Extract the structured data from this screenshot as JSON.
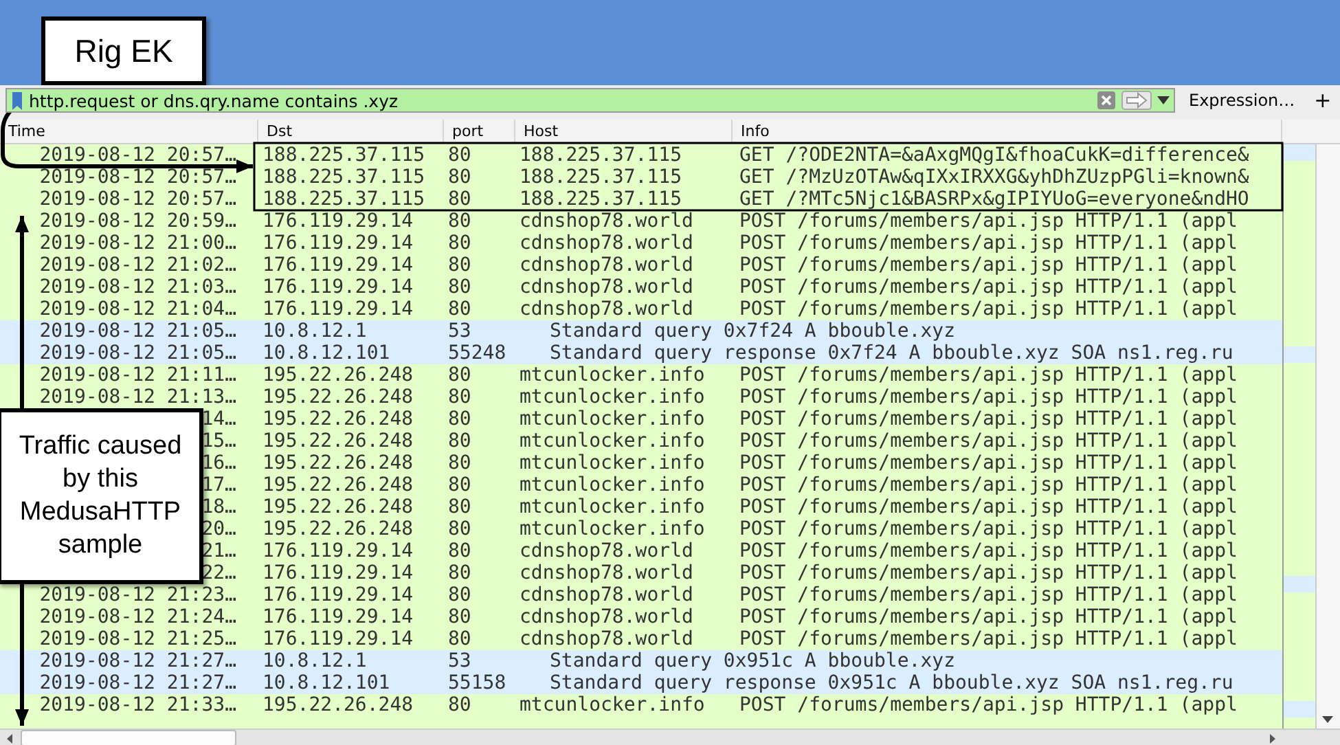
{
  "filter": {
    "value": "http.request or dns.qry.name contains .xyz",
    "expression_button": "Expression…",
    "add_button": "+"
  },
  "columns": [
    "Time",
    "Dst",
    "port",
    "Host",
    "Info"
  ],
  "rows": [
    {
      "kind": "http",
      "time": "2019-08-12 20:57…",
      "dst": "188.225.37.115",
      "port": "80",
      "host": "188.225.37.115",
      "info": "GET /?ODE2NTA=&aAxgMQgI&fhoaCukK=difference&"
    },
    {
      "kind": "http",
      "time": "2019-08-12 20:57…",
      "dst": "188.225.37.115",
      "port": "80",
      "host": "188.225.37.115",
      "info": "GET /?MzUzOTAw&qIXxIRXXG&yhDhZUzpPGli=known&"
    },
    {
      "kind": "http",
      "time": "2019-08-12 20:57…",
      "dst": "188.225.37.115",
      "port": "80",
      "host": "188.225.37.115",
      "info": "GET /?MTc5Njc1&BASRPx&gIPIYUoG=everyone&ndHO"
    },
    {
      "kind": "http",
      "time": "2019-08-12 20:59…",
      "dst": "176.119.29.14",
      "port": "80",
      "host": "cdnshop78.world",
      "info": "POST /forums/members/api.jsp HTTP/1.1  (appl"
    },
    {
      "kind": "http",
      "time": "2019-08-12 21:00…",
      "dst": "176.119.29.14",
      "port": "80",
      "host": "cdnshop78.world",
      "info": "POST /forums/members/api.jsp HTTP/1.1  (appl"
    },
    {
      "kind": "http",
      "time": "2019-08-12 21:02…",
      "dst": "176.119.29.14",
      "port": "80",
      "host": "cdnshop78.world",
      "info": "POST /forums/members/api.jsp HTTP/1.1  (appl"
    },
    {
      "kind": "http",
      "time": "2019-08-12 21:03…",
      "dst": "176.119.29.14",
      "port": "80",
      "host": "cdnshop78.world",
      "info": "POST /forums/members/api.jsp HTTP/1.1  (appl"
    },
    {
      "kind": "http",
      "time": "2019-08-12 21:04…",
      "dst": "176.119.29.14",
      "port": "80",
      "host": "cdnshop78.world",
      "info": "POST /forums/members/api.jsp HTTP/1.1  (appl"
    },
    {
      "kind": "dns",
      "time": "2019-08-12 21:05…",
      "dst": "10.8.12.1",
      "port": "53",
      "info": "Standard query 0x7f24 A bbouble.xyz"
    },
    {
      "kind": "dns",
      "time": "2019-08-12 21:05…",
      "dst": "10.8.12.101",
      "port": "55248",
      "info": "Standard query response 0x7f24 A bbouble.xyz SOA ns1.reg.ru"
    },
    {
      "kind": "http",
      "time": "2019-08-12 21:11…",
      "dst": "195.22.26.248",
      "port": "80",
      "host": "mtcunlocker.info",
      "info": "POST /forums/members/api.jsp HTTP/1.1  (appl"
    },
    {
      "kind": "http",
      "time": "2019-08-12 21:13…",
      "dst": "195.22.26.248",
      "port": "80",
      "host": "mtcunlocker.info",
      "info": "POST /forums/members/api.jsp HTTP/1.1  (appl"
    },
    {
      "kind": "http",
      "time": "14…",
      "dst": "195.22.26.248",
      "port": "80",
      "host": "mtcunlocker.info",
      "info": "POST /forums/members/api.jsp HTTP/1.1  (appl"
    },
    {
      "kind": "http",
      "time": "15…",
      "dst": "195.22.26.248",
      "port": "80",
      "host": "mtcunlocker.info",
      "info": "POST /forums/members/api.jsp HTTP/1.1  (appl"
    },
    {
      "kind": "http",
      "time": "16…",
      "dst": "195.22.26.248",
      "port": "80",
      "host": "mtcunlocker.info",
      "info": "POST /forums/members/api.jsp HTTP/1.1  (appl"
    },
    {
      "kind": "http",
      "time": "17…",
      "dst": "195.22.26.248",
      "port": "80",
      "host": "mtcunlocker.info",
      "info": "POST /forums/members/api.jsp HTTP/1.1  (appl"
    },
    {
      "kind": "http",
      "time": "18…",
      "dst": "195.22.26.248",
      "port": "80",
      "host": "mtcunlocker.info",
      "info": "POST /forums/members/api.jsp HTTP/1.1  (appl"
    },
    {
      "kind": "http",
      "time": "20…",
      "dst": "195.22.26.248",
      "port": "80",
      "host": "mtcunlocker.info",
      "info": "POST /forums/members/api.jsp HTTP/1.1  (appl"
    },
    {
      "kind": "http",
      "time": "21…",
      "dst": "176.119.29.14",
      "port": "80",
      "host": "cdnshop78.world",
      "info": "POST /forums/members/api.jsp HTTP/1.1  (appl"
    },
    {
      "kind": "http",
      "time": "22…",
      "dst": "176.119.29.14",
      "port": "80",
      "host": "cdnshop78.world",
      "info": "POST /forums/members/api.jsp HTTP/1.1  (appl"
    },
    {
      "kind": "http",
      "time": "2019-08-12 21:23…",
      "dst": "176.119.29.14",
      "port": "80",
      "host": "cdnshop78.world",
      "info": "POST /forums/members/api.jsp HTTP/1.1  (appl"
    },
    {
      "kind": "http",
      "time": "2019-08-12 21:24…",
      "dst": "176.119.29.14",
      "port": "80",
      "host": "cdnshop78.world",
      "info": "POST /forums/members/api.jsp HTTP/1.1  (appl"
    },
    {
      "kind": "http",
      "time": "2019-08-12 21:25…",
      "dst": "176.119.29.14",
      "port": "80",
      "host": "cdnshop78.world",
      "info": "POST /forums/members/api.jsp HTTP/1.1  (appl"
    },
    {
      "kind": "dns",
      "time": "2019-08-12 21:27…",
      "dst": "10.8.12.1",
      "port": "53",
      "info": "Standard query 0x951c A bbouble.xyz"
    },
    {
      "kind": "dns",
      "time": "2019-08-12 21:27…",
      "dst": "10.8.12.101",
      "port": "55158",
      "info": "Standard query response 0x951c A bbouble.xyz SOA ns1.reg.ru"
    },
    {
      "kind": "http",
      "time": "2019-08-12 21:33…",
      "dst": "195.22.26.248",
      "port": "80",
      "host": "mtcunlocker.info",
      "info": "POST /forums/members/api.jsp HTTP/1.1  (appl"
    }
  ],
  "annotations": [
    {
      "kind": "label",
      "text": "Rig EK"
    },
    {
      "kind": "callout",
      "text": "Traffic caused by this MedusaHTTP sample"
    }
  ]
}
